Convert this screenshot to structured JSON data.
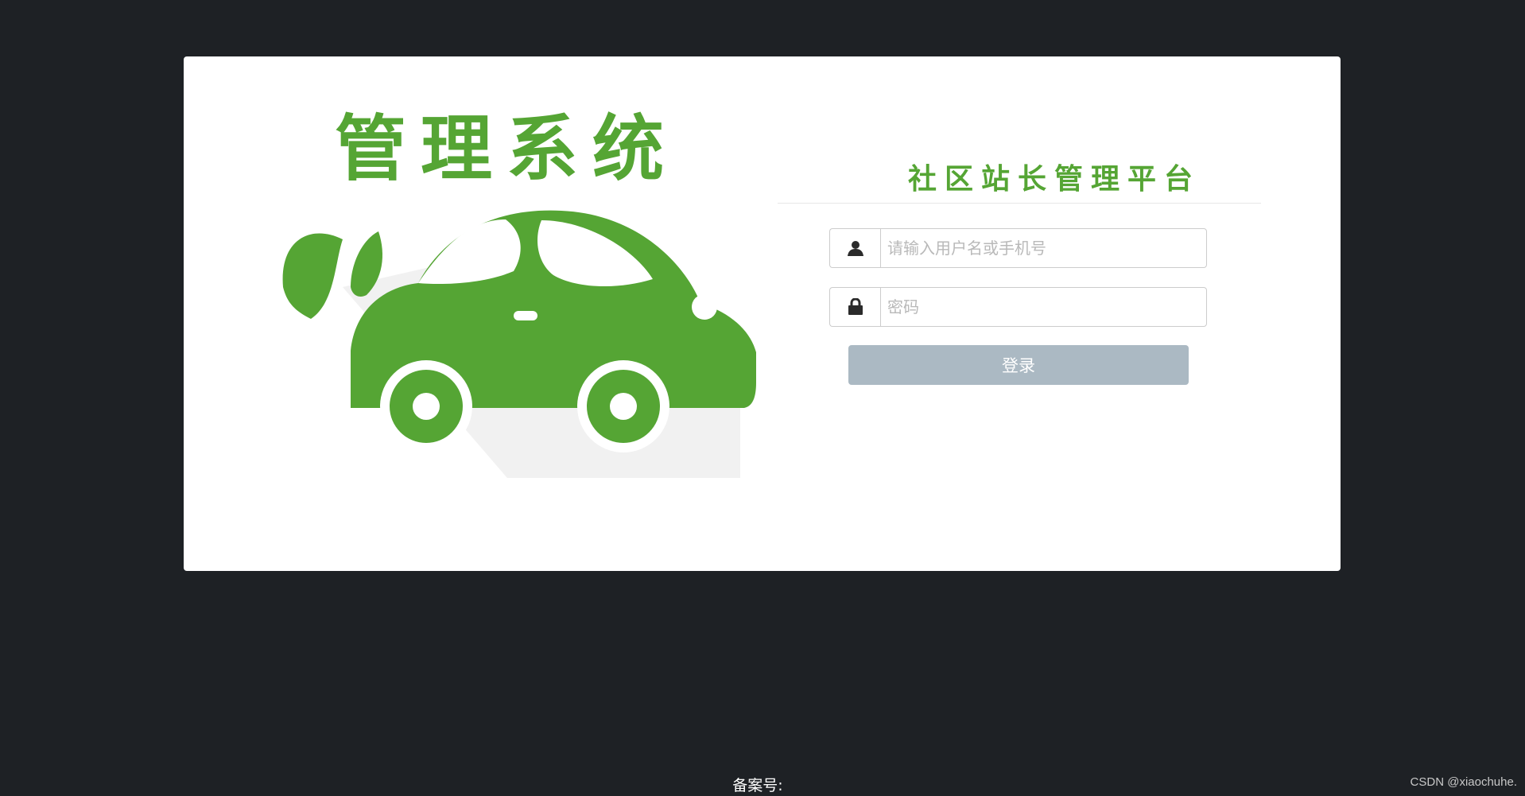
{
  "logo": {
    "title": "管理系统",
    "image_name": "green-car-logo"
  },
  "platform": {
    "title": "社区站长管理平台"
  },
  "form": {
    "username": {
      "icon": "user-icon",
      "value": "",
      "placeholder": "请输入用户名或手机号"
    },
    "password": {
      "icon": "lock-icon",
      "value": "",
      "placeholder": "密码"
    },
    "login_label": "登录"
  },
  "footer": {
    "record_label": "备案号:"
  },
  "watermark": {
    "text": "CSDN @xiaochuhe."
  },
  "colors": {
    "page_background": "#1e2125",
    "card_background": "#ffffff",
    "brand_green": "#55a534",
    "button_background": "#abb9c3",
    "input_border": "#cccccc"
  }
}
